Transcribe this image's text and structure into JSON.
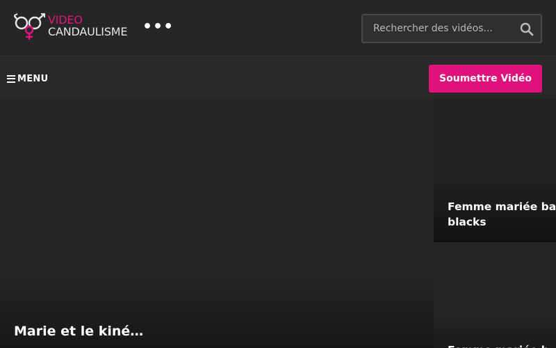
{
  "header": {
    "logo": {
      "line1": "VIDEO",
      "line2": "CANDAULISME",
      "accent_color": "#e0167a"
    },
    "more_icon": "ellipsis-icon",
    "more_label": "•••",
    "search": {
      "placeholder": "Rechercher des vidéos...",
      "icon": "search-icon"
    }
  },
  "nav": {
    "menu_label": "MENU",
    "menu_icon": "hamburger-icon",
    "submit_label": "Soumettre Vidéo",
    "submit_color": "#e0117a"
  },
  "videos": [
    {
      "title": "Marie et le kiné…"
    },
    {
      "title": "Femme mariée ba blacks"
    },
    {
      "title": "Femme mariée b"
    }
  ]
}
